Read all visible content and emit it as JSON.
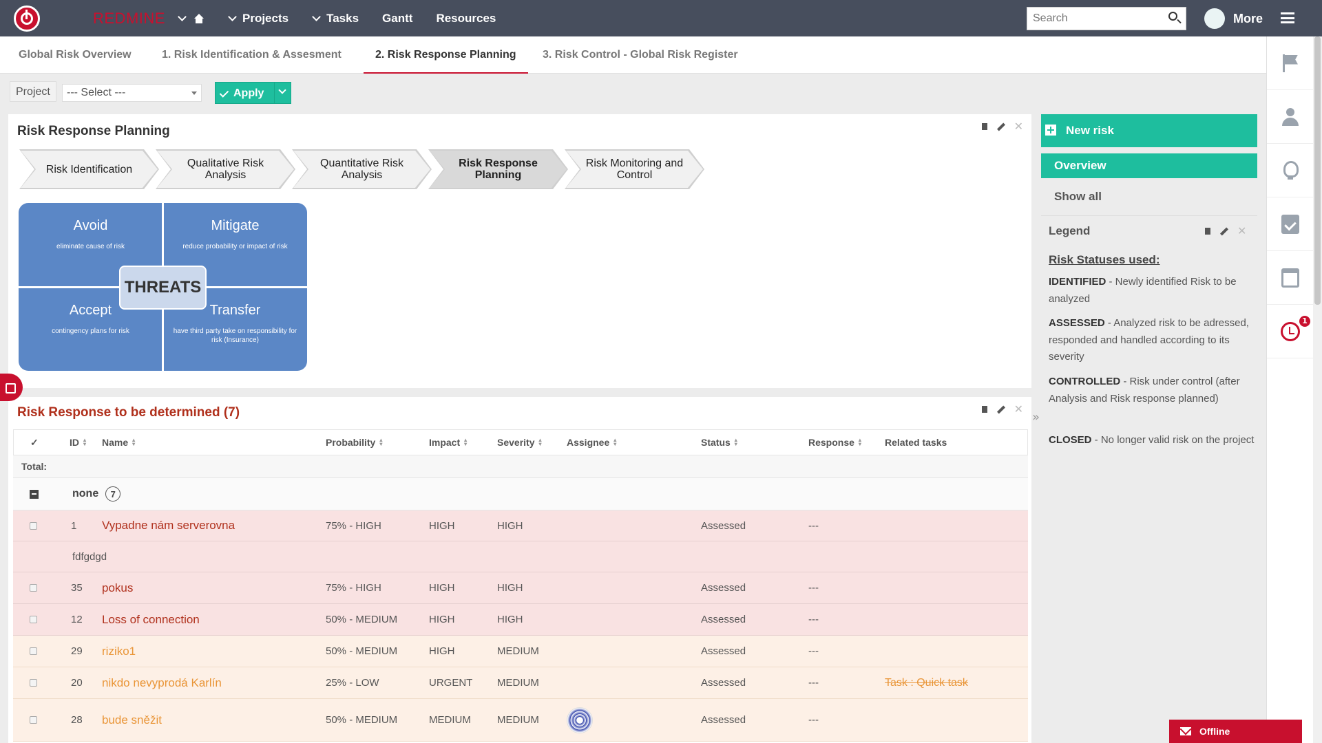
{
  "header": {
    "brand": "REDMINE",
    "nav": [
      "Projects",
      "Tasks",
      "Gantt",
      "Resources"
    ],
    "search_placeholder": "Search",
    "more": "More"
  },
  "tabs": [
    "Global Risk Overview",
    "1. Risk Identification & Assesment",
    "2. Risk Response Planning",
    "3. Risk Control - Global Risk Register"
  ],
  "filter": {
    "project_label": "Project",
    "project_value": "--- Select ---",
    "apply_label": "Apply"
  },
  "planning": {
    "title": "Risk Response Planning",
    "steps": [
      {
        "l1": "Risk Identification",
        "l2": ""
      },
      {
        "l1": "Qualitative Risk",
        "l2": "Analysis"
      },
      {
        "l1": "Quantitative Risk",
        "l2": "Analysis"
      },
      {
        "l1": "Risk Response",
        "l2": "Planning"
      },
      {
        "l1": "Risk Monitoring and",
        "l2": "Control"
      }
    ],
    "threats": {
      "center": "THREATS",
      "avoid": {
        "title": "Avoid",
        "sub": "eliminate cause of risk"
      },
      "mitigate": {
        "title": "Mitigate",
        "sub": "reduce probability or impact of risk"
      },
      "accept": {
        "title": "Accept",
        "sub": "contingency plans for risk"
      },
      "transfer": {
        "title": "Transfer",
        "sub": "have third party take on responsibility for risk (Insurance)"
      }
    }
  },
  "sidebar": {
    "new_risk": "New risk",
    "overview": "Overview",
    "show_all": "Show all",
    "legend": {
      "title": "Legend",
      "subtitle": "Risk Statuses used:",
      "items": [
        {
          "key": "IDENTIFIED",
          "desc": " - Newly identified Risk to be analyzed"
        },
        {
          "key": "ASSESSED",
          "desc": " - Analyzed risk to be adressed, responded and handled according to its severity"
        },
        {
          "key": "CONTROLLED",
          "desc": " - Risk under control (after Analysis and Risk response planned)"
        },
        {
          "key": "CLOSED",
          "desc": " - No longer valid risk on the project"
        }
      ]
    }
  },
  "responses": {
    "title": "Risk Response to be determined (7)",
    "columns": {
      "check": "✓",
      "id": "ID",
      "name": "Name",
      "probability": "Probability",
      "impact": "Impact",
      "severity": "Severity",
      "assignee": "Assignee",
      "status": "Status",
      "response": "Response",
      "related": "Related tasks"
    },
    "total_label": "Total:",
    "group": {
      "name": "none",
      "count": "7"
    },
    "rows": [
      {
        "id": "1",
        "name": "Vypadne nám serverovna",
        "probability": "75% - HIGH",
        "impact": "HIGH",
        "severity": "HIGH",
        "status": "Assessed",
        "response": "---",
        "related": "",
        "note": "fdfgdgd"
      },
      {
        "id": "35",
        "name": "pokus",
        "probability": "75% - HIGH",
        "impact": "HIGH",
        "severity": "HIGH",
        "status": "Assessed",
        "response": "---",
        "related": ""
      },
      {
        "id": "12",
        "name": "Loss of connection",
        "probability": "50% - MEDIUM",
        "impact": "HIGH",
        "severity": "HIGH",
        "status": "Assessed",
        "response": "---",
        "related": ""
      },
      {
        "id": "29",
        "name": "riziko1",
        "probability": "50% - MEDIUM",
        "impact": "HIGH",
        "severity": "MEDIUM",
        "status": "Assessed",
        "response": "---",
        "related": ""
      },
      {
        "id": "20",
        "name": "nikdo nevyprodá Karlín",
        "probability": "25% - LOW",
        "impact": "URGENT",
        "severity": "MEDIUM",
        "status": "Assessed",
        "response": "---",
        "related": "Task : Quick task"
      },
      {
        "id": "28",
        "name": "bude sněžit",
        "probability": "50% - MEDIUM",
        "impact": "MEDIUM",
        "severity": "MEDIUM",
        "status": "Assessed",
        "response": "---",
        "related": ""
      }
    ]
  },
  "offline": "Offline",
  "notification_count": "1",
  "colors": {
    "accent": "#1ebe9e",
    "brand": "#c8102e",
    "high_row": "#f9e2e2",
    "medium_row": "#fdf0e6",
    "high_text": "#b0301c",
    "medium_text": "#e99537"
  }
}
